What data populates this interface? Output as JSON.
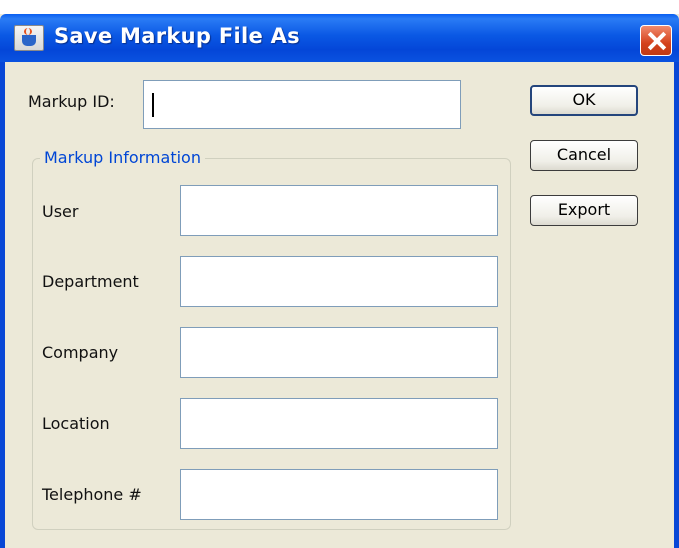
{
  "window": {
    "title": "Save Markup File As"
  },
  "form": {
    "markup_id_label": "Markup ID:",
    "markup_id_value": ""
  },
  "group": {
    "title": "Markup Information",
    "fields": [
      {
        "label": "User",
        "value": ""
      },
      {
        "label": "Department",
        "value": ""
      },
      {
        "label": "Company",
        "value": ""
      },
      {
        "label": "Location",
        "value": ""
      },
      {
        "label": "Telephone #",
        "value": ""
      }
    ]
  },
  "buttons": {
    "ok": "OK",
    "cancel": "Cancel",
    "export": "Export"
  },
  "icons": {
    "title_icon": "java-cup-icon",
    "close": "close-icon"
  },
  "colors": {
    "titlebar": "#0a58e4",
    "close": "#d4421c",
    "group_title": "#0046d5",
    "background": "#ece9d8"
  }
}
